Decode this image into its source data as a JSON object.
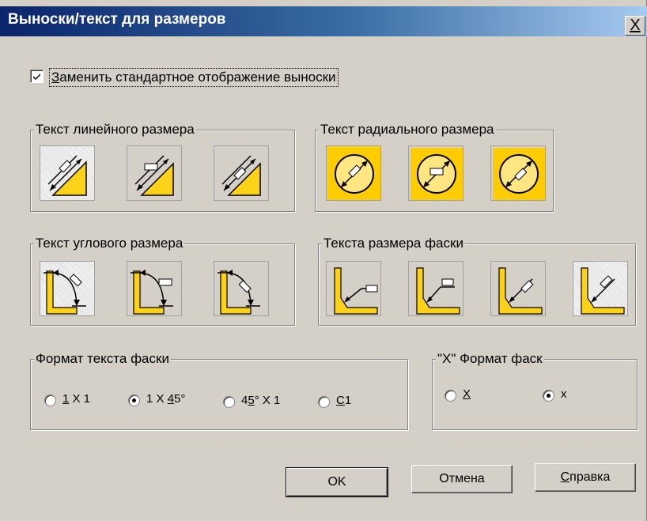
{
  "dialog": {
    "title": "Выноски/текст для размеров",
    "close_label": "X"
  },
  "replace_checkbox": {
    "label_hot": "З",
    "label_rest": "аменить стандартное отображение выноски",
    "checked": true
  },
  "groups": {
    "linear": {
      "title": "Текст линейного размера",
      "selected_index": 0,
      "icons": [
        "linear-text-above-icon",
        "linear-text-horizontal-icon",
        "linear-text-aligned-icon"
      ]
    },
    "radial": {
      "title": "Текст радиального размера",
      "icons": [
        "radial-text-aligned-icon",
        "radial-text-horizontal-icon",
        "radial-text-inline-icon"
      ]
    },
    "angular": {
      "title": "Текст углового размера",
      "selected_index": 0,
      "icons": [
        "angular-text-aligned-icon",
        "angular-text-horizontal-icon",
        "angular-text-above-icon"
      ]
    },
    "chamfer": {
      "title": "Текста размера фаски",
      "selected_index": 3,
      "icons": [
        "chamfer-leader-horizontal-icon",
        "chamfer-leader-boxed-icon",
        "chamfer-leader-aligned-icon",
        "chamfer-leader-above-icon"
      ]
    }
  },
  "chamfer_format": {
    "title": "Формат текста фаски",
    "options": [
      {
        "hot": "1",
        "rest": " X 1",
        "checked": false
      },
      {
        "pre": "1 X ",
        "hot": "4",
        "rest": "5°",
        "checked": true
      },
      {
        "pre": "4",
        "hot": "5",
        "rest": "° X 1",
        "checked": false
      },
      {
        "hot": "C",
        "rest": "1",
        "checked": false
      }
    ]
  },
  "x_format": {
    "title": "\"X\" Формат фаск",
    "options": [
      {
        "label": "X",
        "checked": false
      },
      {
        "label": "x",
        "checked": true
      }
    ]
  },
  "buttons": {
    "ok": "OK",
    "cancel": "Отмена",
    "help_hot": "С",
    "help_rest": "правка"
  },
  "colors": {
    "title_start": "#0a246a",
    "title_end": "#a6caf0",
    "face": "#d4d0c8",
    "icon_yellow": "#ffd21a"
  }
}
